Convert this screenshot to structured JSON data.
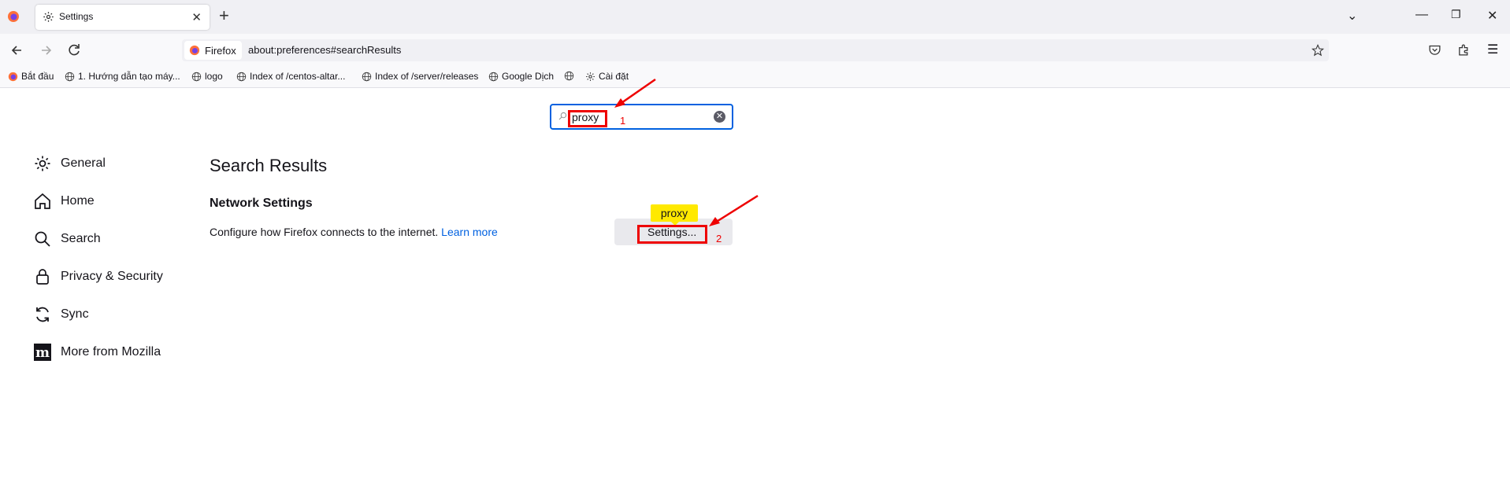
{
  "browser": {
    "tab": {
      "title": "Settings"
    },
    "url_identity": "Firefox",
    "url": "about:preferences#searchResults"
  },
  "bookmarks": [
    "Bắt đầu",
    "1. Hướng dẫn tạo máy...",
    "logo",
    "Index of /centos-altar...",
    "Index of /server/releases",
    "Google Dịch",
    "Cài đặt"
  ],
  "search": {
    "value": "proxy"
  },
  "sidebar": {
    "items": [
      {
        "label": "General",
        "icon": "gear-icon"
      },
      {
        "label": "Home",
        "icon": "home-icon"
      },
      {
        "label": "Search",
        "icon": "search-icon"
      },
      {
        "label": "Privacy & Security",
        "icon": "lock-icon"
      },
      {
        "label": "Sync",
        "icon": "sync-icon"
      },
      {
        "label": "More from Mozilla",
        "icon": "mozilla-icon"
      }
    ]
  },
  "main": {
    "results_title": "Search Results",
    "network": {
      "title": "Network Settings",
      "description": "Configure how Firefox connects to the internet.",
      "learn_more": "Learn more",
      "settings_button": "Settings...",
      "highlight_tooltip": "proxy"
    }
  },
  "annotations": {
    "step1": "1",
    "step2": "2"
  },
  "colors": {
    "accent": "#0061e0",
    "annotation": "#e00000",
    "highlight": "#ffe900"
  }
}
